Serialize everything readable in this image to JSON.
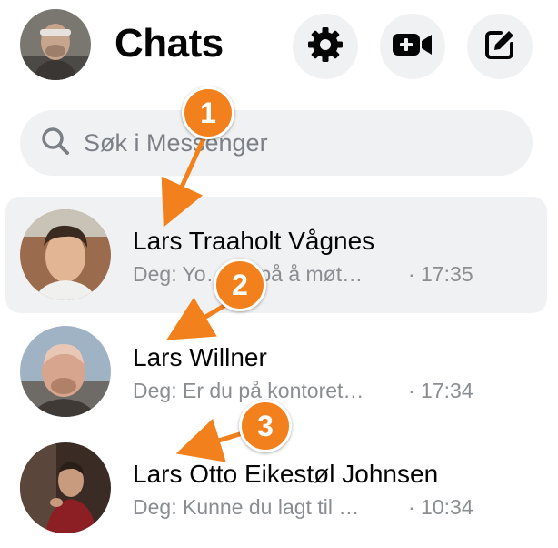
{
  "header": {
    "title": "Chats",
    "buttons": [
      {
        "icon": "gear-icon"
      },
      {
        "icon": "video-plus-icon"
      },
      {
        "icon": "compose-icon"
      }
    ]
  },
  "search": {
    "placeholder": "Søk i Messenger",
    "icon": "search-icon"
  },
  "chats": [
    {
      "name": "Lars Traaholt Vågnes",
      "preview": "Deg: Yo… … på å møt…",
      "time": "· 17:35",
      "active": true
    },
    {
      "name": "Lars Willner",
      "preview": "Deg: Er du på kontoret…",
      "time": "· 17:34",
      "active": false
    },
    {
      "name": "Lars Otto Eikestøl Johnsen",
      "preview": "Deg: Kunne du lagt til …",
      "time": "· 10:34",
      "active": false
    }
  ],
  "annotations": [
    {
      "label": "1"
    },
    {
      "label": "2"
    },
    {
      "label": "3"
    }
  ],
  "colors": {
    "accent": "#f2811d",
    "button_bg": "#f0f1f3",
    "secondary_text": "#8a8d91"
  }
}
